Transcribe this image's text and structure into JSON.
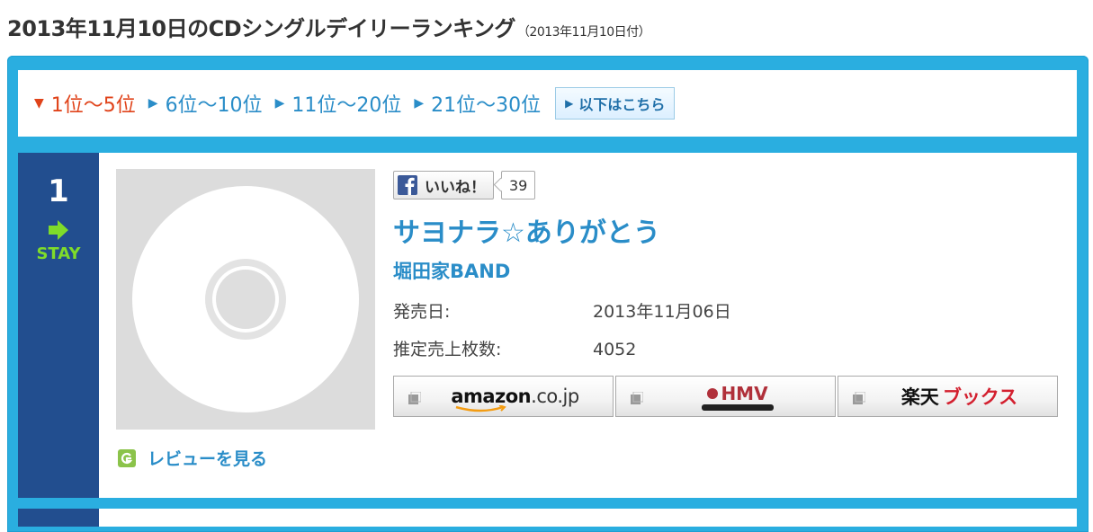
{
  "page": {
    "title": "2013年11月10日のCDシングルデイリーランキング",
    "date_note": "（2013年11月10日付）"
  },
  "tabs": [
    {
      "label": "1位〜5位",
      "active": true
    },
    {
      "label": "6位〜10位",
      "active": false
    },
    {
      "label": "11位〜20位",
      "active": false
    },
    {
      "label": "21位〜30位",
      "active": false
    }
  ],
  "more_button": {
    "label": "以下はこちら"
  },
  "entry": {
    "rank": "1",
    "movement": "STAY",
    "like": {
      "label": "いいね！",
      "count": "39"
    },
    "title": "サヨナラ☆ありがとう",
    "artist": "堀田家BAND",
    "release_label": "発売日:",
    "release_value": "2013年11月06日",
    "sales_label": "推定売上枚数:",
    "sales_value": "4052",
    "review_link": "レビューを見る",
    "shops": {
      "amazon": {
        "main": "amazon",
        "suffix": ".co.jp"
      },
      "hmv": {
        "main": "HMV"
      },
      "rakuten": {
        "main": "楽天",
        "suffix": "ブックス"
      }
    }
  },
  "colors": {
    "accent_blue": "#2a8dc8",
    "panel_blue": "#2aaee0",
    "rank_blue": "#224e8f",
    "active_tab": "#e0431a",
    "stay_green": "#7fdc2a"
  }
}
